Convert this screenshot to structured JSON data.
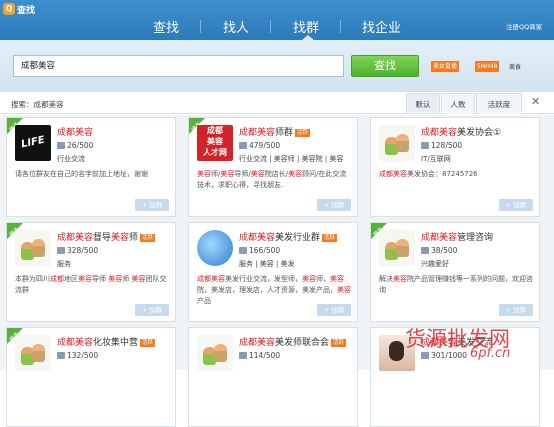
{
  "window": {
    "title": "查找"
  },
  "nav": {
    "tabs": [
      "查找",
      "找人",
      "找群",
      "找企业"
    ],
    "active": 2,
    "right_link": "注册QQ商家"
  },
  "search": {
    "value": "成都美容",
    "button": "查找",
    "hot_tags": [
      "美女直播",
      "5NH48"
    ],
    "hot_tag_plain": "美食"
  },
  "filter": {
    "label": "搜索：成都美容",
    "sorts": [
      "默认",
      "人数",
      "活跃度"
    ],
    "active_sort": 0,
    "close": "✕"
  },
  "cards": [
    {
      "ribbon": "精选",
      "title_parts": [
        [
          "成都美容",
          true
        ]
      ],
      "badge": "",
      "members": "26/500",
      "tags": "行业交流",
      "desc": [
        [
          "请各位群友在自己的名字前加上地址，谢谢",
          false
        ]
      ],
      "join": "+ 加群",
      "thumb": "life"
    },
    {
      "ribbon": "精选",
      "title_parts": [
        [
          "成都美容",
          true
        ],
        [
          "师群",
          false
        ]
      ],
      "badge": "活跃",
      "members": "479/500",
      "tags": "行业交流 | 美容师 | 美容院 | 美容",
      "desc": [
        [
          "美容",
          true
        ],
        [
          "师/",
          false
        ],
        [
          "美容",
          true
        ],
        [
          "导师/",
          false
        ],
        [
          "美容",
          true
        ],
        [
          "院店长/",
          false
        ],
        [
          "美容",
          true
        ],
        [
          "顾问/在此交流技术，求职心得，寻找朋友.",
          false
        ]
      ],
      "join": "+ 加群",
      "thumb": "logo",
      "thumb_text": [
        "成都",
        "美容",
        "人才网"
      ]
    },
    {
      "ribbon": "",
      "title_parts": [
        [
          "成都美容",
          true
        ],
        [
          "美发协会①",
          false
        ]
      ],
      "badge": "",
      "members": "128/500",
      "tags": "IT/互联网",
      "desc": [
        [
          "成都美容",
          true
        ],
        [
          "美发协会：87245726",
          false
        ]
      ],
      "join": "+ 加群",
      "thumb": "avatar2"
    },
    {
      "ribbon": "精选",
      "title_parts": [
        [
          "成都美容",
          true
        ],
        [
          "督导",
          false
        ],
        [
          "美容",
          true
        ],
        [
          "师",
          false
        ]
      ],
      "badge": "活跃",
      "members": "328/500",
      "tags": "服务",
      "desc": [
        [
          "本群为四川",
          false
        ],
        [
          "成都",
          true
        ],
        [
          "地区",
          false
        ],
        [
          "美容",
          true
        ],
        [
          "导师 ",
          false
        ],
        [
          "美容",
          true
        ],
        [
          "师 ",
          false
        ],
        [
          "美容",
          true
        ],
        [
          "团队交流群",
          false
        ]
      ],
      "join": "+ 加群",
      "thumb": "avatar2"
    },
    {
      "ribbon": "",
      "title_parts": [
        [
          "成都美容",
          true
        ],
        [
          "美发行业群",
          false
        ]
      ],
      "badge": "活跃",
      "members": "166/500",
      "tags": "服务 | 美容 | 美发",
      "desc": [
        [
          "成都美容",
          true
        ],
        [
          "美发",
          false
        ],
        [
          "行业交流，发型师，",
          false
        ],
        [
          "美容",
          true
        ],
        [
          "师，",
          false
        ],
        [
          "美容",
          true
        ],
        [
          "院，美发店，理发店，人才资源，美发产品，",
          false
        ],
        [
          "美容",
          true
        ],
        [
          "产品",
          false
        ]
      ],
      "join": "+ 加群",
      "thumb": "globe"
    },
    {
      "ribbon": "精选",
      "title_parts": [
        [
          "成都美容",
          true
        ],
        [
          "管理咨询",
          false
        ]
      ],
      "badge": "",
      "members": "38/500",
      "tags": "兴趣爱好",
      "desc": [
        [
          "解决",
          false
        ],
        [
          "美容",
          true
        ],
        [
          "院产品管理赚钱等一系列的问题，欢迎咨询",
          false
        ]
      ],
      "join": "+ 加群",
      "thumb": "avatar2"
    },
    {
      "ribbon": "精选",
      "title_parts": [
        [
          "成都美容",
          true
        ],
        [
          "化妆集中营",
          false
        ]
      ],
      "badge": "活跃",
      "members": "132/500",
      "tags": "",
      "desc": [],
      "join": "",
      "thumb": "avatar2"
    },
    {
      "ribbon": "",
      "title_parts": [
        [
          "成都美容",
          true
        ],
        [
          "美发师联合会",
          false
        ]
      ],
      "badge": "活跃",
      "members": "114/500",
      "tags": "",
      "desc": [],
      "join": "",
      "thumb": "avatar2"
    },
    {
      "ribbon": "",
      "title_parts": [
        [
          "成都美容",
          true
        ],
        [
          "美发交流",
          false
        ]
      ],
      "badge": "",
      "members": "301/1000",
      "tags": "",
      "desc": [],
      "join": "",
      "thumb": "photo"
    }
  ],
  "watermark": {
    "line1": "货源批发网",
    "line2": "6pf.cn"
  },
  "colors": {
    "accent_red": "#d8202a",
    "header_blue": "#2d7ab9",
    "search_green": "#4db32a",
    "badge_orange": "#f47920",
    "ribbon_green": "#58b13b"
  }
}
